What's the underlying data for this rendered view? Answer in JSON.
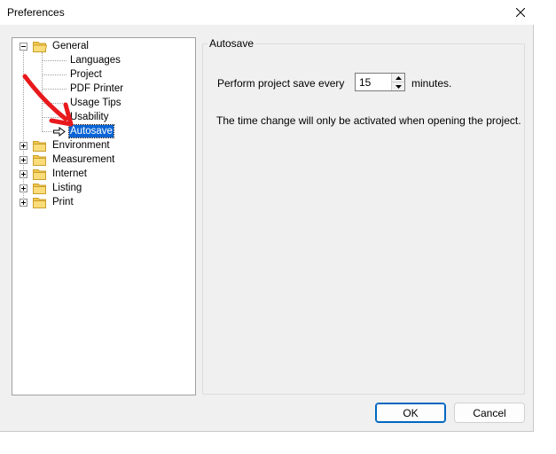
{
  "window": {
    "title": "Preferences"
  },
  "tree": {
    "root": {
      "label": "General",
      "children": [
        "Languages",
        "Project",
        "PDF Printer",
        "Usage Tips",
        "Usability",
        "Autosave"
      ],
      "selected_child": "Autosave"
    },
    "collapsed_nodes": [
      "Environment",
      "Measurement",
      "Internet",
      "Listing",
      "Print"
    ]
  },
  "autosave": {
    "group_title": "Autosave",
    "label_before": "Perform project save every",
    "interval_value": "15",
    "label_after": "minutes.",
    "note": "The time change will only be activated when opening the project."
  },
  "buttons": {
    "ok": "OK",
    "cancel": "Cancel"
  },
  "colors": {
    "selection": "#0a64d6",
    "annotation_arrow": "#e8191c",
    "folder": "#f3c74f"
  }
}
